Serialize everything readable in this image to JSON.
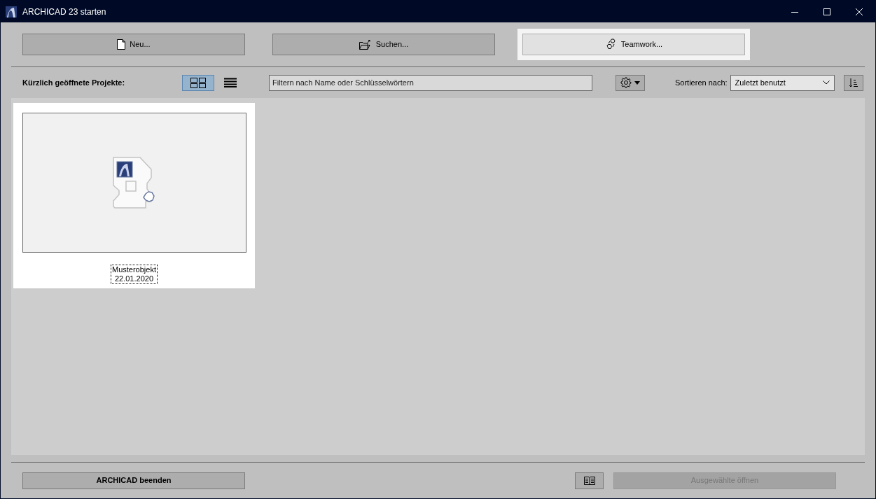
{
  "window": {
    "title": "ARCHICAD 23 starten"
  },
  "top_buttons": [
    {
      "kind": "new",
      "label": "Neu...",
      "highlighted": false
    },
    {
      "kind": "open",
      "label": "Suchen...",
      "highlighted": false
    },
    {
      "kind": "teamwork",
      "label": "Teamwork...",
      "highlighted": true
    }
  ],
  "toolbar": {
    "recent_label": "Kürzlich geöffnete Projekte:",
    "views": [
      {
        "kind": "grid",
        "selected": true
      },
      {
        "kind": "list",
        "selected": false
      }
    ],
    "filter": {
      "placeholder": "Filtern nach Name oder Schlüsselwörtern"
    },
    "sort_label": "Sortieren nach:",
    "sort_value": "Zuletzt benutzt"
  },
  "projects": [
    {
      "name": "Musterobjekt",
      "date": "22.01.2020",
      "selected": true
    }
  ],
  "bottom": {
    "quit_button": "ARCHICAD beenden",
    "open_button": {
      "label": "Ausgewählte öffnen",
      "disabled": true
    }
  }
}
